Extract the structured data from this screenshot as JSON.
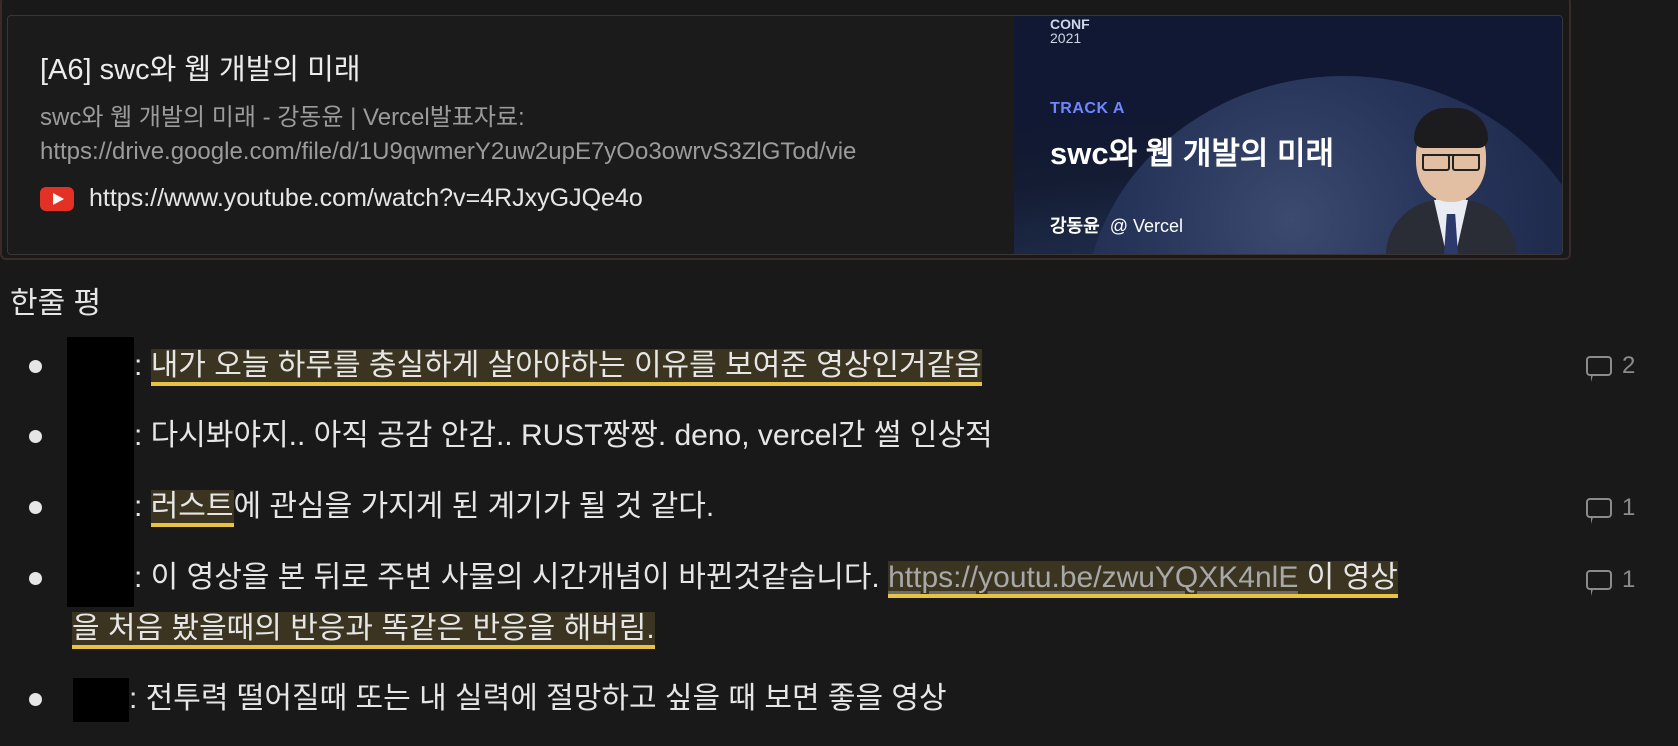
{
  "bookmark": {
    "title": "[A6] swc와 웹 개발의 미래",
    "description_line1": "swc와 웹 개발의 미래 - 강동윤 | Vercel발표자료:",
    "description_line2": "https://drive.google.com/file/d/1U9qwmerY2uw2upE7yOo3owrvS3ZlGTod/vie",
    "url": "https://www.youtube.com/watch?v=4RJxyGJQe4o",
    "icon": "youtube-icon",
    "thumbnail": {
      "conf": "CONF",
      "year": "2021",
      "track": "TRACK A",
      "talk_title": "swc와 웹 개발의 미래",
      "speaker": "강동윤",
      "affiliation": "@ Vercel"
    }
  },
  "section_heading": "한줄 평",
  "comments_list": [
    {
      "prefix": ":",
      "highlight": "내가 오늘 하루를 충실하게 살아야하는 이유를 보여준 영상인거같음",
      "comment_count": "2"
    },
    {
      "prefix": ": 다시봐야지.. 아직 공감 안감.. RUST짱짱. deno, vercel간 썰 인상적"
    },
    {
      "prefix": ":",
      "highlight": "러스트",
      "rest": "에 관심을 가지게 된 계기가 될 것 같다.",
      "comment_count": "1"
    },
    {
      "prefix": ": 이 영상을 본 뒤로 주변 사물의 시간개념이 바뀐것같습니다.",
      "link": "https://youtu.be/zwuYQXK4nlE",
      "highlight_after_link": " 이 영상",
      "line2_highlight": "을 처음 봤을때의 반응과 똑같은 반응을 해버림.",
      "comment_count": "1"
    },
    {
      "prefix": ": 전투력 떨어질때 또는 내 실력에 절망하고 싶을 때 보면 좋을 영상"
    }
  ],
  "colors": {
    "background": "#191919",
    "highlight_bg": "#3a3420",
    "highlight_underline": "#e8c341",
    "redaction": "#000000"
  }
}
